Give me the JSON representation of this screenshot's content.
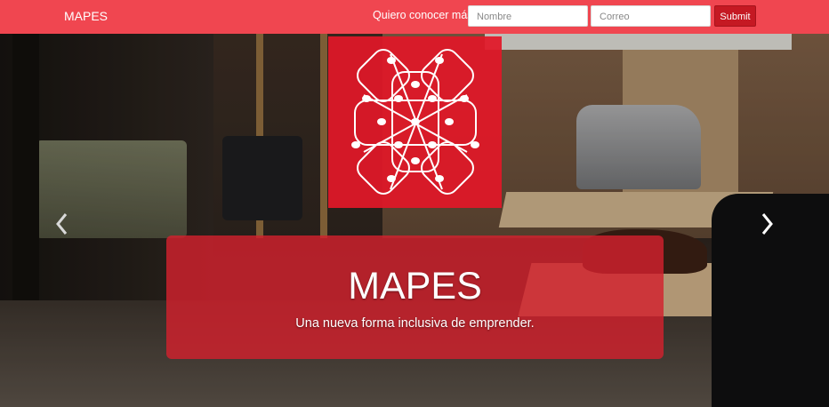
{
  "navbar": {
    "brand": "MAPES",
    "signup_label": "Quiero conocer más:",
    "name_placeholder": "Nombre",
    "email_placeholder": "Correo",
    "submit_label": "Submit",
    "color": "#f04650"
  },
  "carousel": {
    "title": "MAPES",
    "subtitle": "Una nueva forma inclusiva de emprender.",
    "prev_icon": "chevron-left-icon",
    "next_icon": "chevron-right-icon",
    "caption_color": "#d2212d",
    "logo_color": "#e11828"
  }
}
